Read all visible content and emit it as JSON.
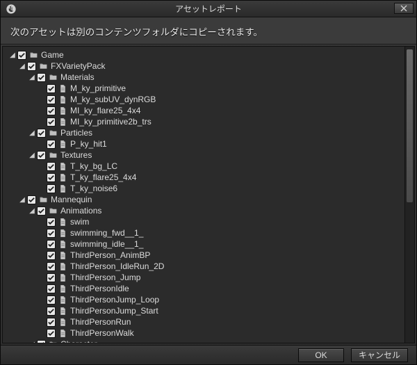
{
  "window": {
    "title": "アセットレポート",
    "info_text": "次のアセットは別のコンテンツフォルダにコピーされます。"
  },
  "buttons": {
    "ok": "OK",
    "cancel": "キャンセル"
  },
  "tree": [
    {
      "depth": 0,
      "expanded": true,
      "checked": true,
      "icon": "folder",
      "label": "Game"
    },
    {
      "depth": 1,
      "expanded": true,
      "checked": true,
      "icon": "folder",
      "label": "FXVarietyPack"
    },
    {
      "depth": 2,
      "expanded": true,
      "checked": true,
      "icon": "folder",
      "label": "Materials"
    },
    {
      "depth": 3,
      "checked": true,
      "icon": "file",
      "label": "M_ky_primitive"
    },
    {
      "depth": 3,
      "checked": true,
      "icon": "file",
      "label": "M_ky_subUV_dynRGB"
    },
    {
      "depth": 3,
      "checked": true,
      "icon": "file",
      "label": "MI_ky_flare25_4x4"
    },
    {
      "depth": 3,
      "checked": true,
      "icon": "file",
      "label": "MI_ky_primitive2b_trs"
    },
    {
      "depth": 2,
      "expanded": true,
      "checked": true,
      "icon": "folder",
      "label": "Particles"
    },
    {
      "depth": 3,
      "checked": true,
      "icon": "file",
      "label": "P_ky_hit1"
    },
    {
      "depth": 2,
      "expanded": true,
      "checked": true,
      "icon": "folder",
      "label": "Textures"
    },
    {
      "depth": 3,
      "checked": true,
      "icon": "file",
      "label": "T_ky_bg_LC"
    },
    {
      "depth": 3,
      "checked": true,
      "icon": "file",
      "label": "T_ky_flare25_4x4"
    },
    {
      "depth": 3,
      "checked": true,
      "icon": "file",
      "label": "T_ky_noise6"
    },
    {
      "depth": 1,
      "expanded": true,
      "checked": true,
      "icon": "folder",
      "label": "Mannequin"
    },
    {
      "depth": 2,
      "expanded": true,
      "checked": true,
      "icon": "folder",
      "label": "Animations"
    },
    {
      "depth": 3,
      "checked": true,
      "icon": "file",
      "label": "swim"
    },
    {
      "depth": 3,
      "checked": true,
      "icon": "file",
      "label": "swimming_fwd__1_"
    },
    {
      "depth": 3,
      "checked": true,
      "icon": "file",
      "label": "swimming_idle__1_"
    },
    {
      "depth": 3,
      "checked": true,
      "icon": "file",
      "label": "ThirdPerson_AnimBP"
    },
    {
      "depth": 3,
      "checked": true,
      "icon": "file",
      "label": "ThirdPerson_IdleRun_2D"
    },
    {
      "depth": 3,
      "checked": true,
      "icon": "file",
      "label": "ThirdPerson_Jump"
    },
    {
      "depth": 3,
      "checked": true,
      "icon": "file",
      "label": "ThirdPersonIdle"
    },
    {
      "depth": 3,
      "checked": true,
      "icon": "file",
      "label": "ThirdPersonJump_Loop"
    },
    {
      "depth": 3,
      "checked": true,
      "icon": "file",
      "label": "ThirdPersonJump_Start"
    },
    {
      "depth": 3,
      "checked": true,
      "icon": "file",
      "label": "ThirdPersonRun"
    },
    {
      "depth": 3,
      "checked": true,
      "icon": "file",
      "label": "ThirdPersonWalk"
    },
    {
      "depth": 2,
      "expanded": true,
      "checked": true,
      "icon": "folder",
      "label": "Character"
    }
  ]
}
